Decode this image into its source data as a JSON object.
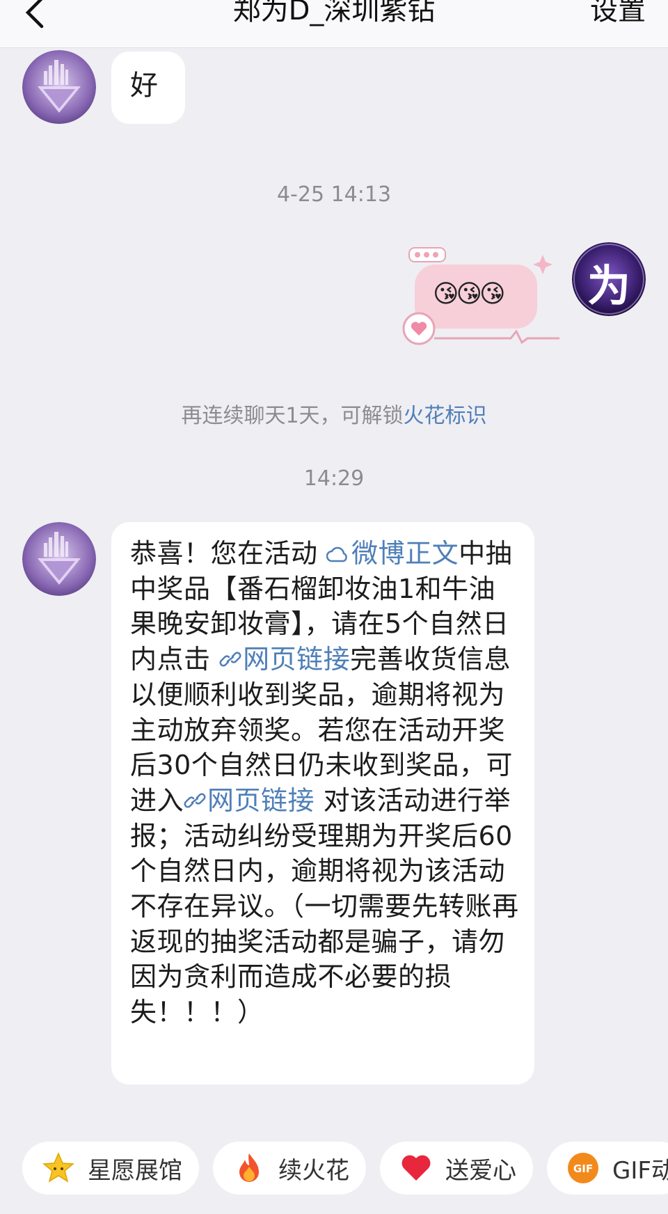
{
  "header": {
    "title": "郑为D_深圳紫钻",
    "settings_label": "设置"
  },
  "messages": {
    "first_text": "好",
    "timestamp_1": "4-25 14:13",
    "sticker_emojis": "😘😘😘",
    "system_notice": {
      "prefix": "再连续聊天1天，可解锁",
      "link": "火花标识"
    },
    "timestamp_2": "14:29",
    "prize": {
      "part1": "恭喜！您在活动 ",
      "link1": "微博正文",
      "part2": "中抽中奖品【番石榴卸妆油1和牛油果晚安卸妆膏】，请在5个自然日内点击 ",
      "link2": "网页链接",
      "part3": "完善收货信息以便顺利收到奖品，逾期将视为主动放弃领奖。若您在活动开奖后30个自然日仍未收到奖品，可进入",
      "link3": "网页链接",
      "part4": " 对该活动进行举报；活动纠纷受理期为开奖后60个自然日内，逾期将视为该活动不存在异议。（一切需要先转账再返现的抽奖活动都是骗子，请勿因为贪利而造成不必要的损失！！！）"
    }
  },
  "avatar_self_char": "为",
  "quick_actions": [
    {
      "label": "星愿展馆",
      "icon": "star-icon"
    },
    {
      "label": "续火花",
      "icon": "flame-icon"
    },
    {
      "label": "送爱心",
      "icon": "heart-icon"
    },
    {
      "label": "GIF动",
      "icon": "gif-icon"
    }
  ],
  "colors": {
    "link": "#4f7fb8",
    "background": "#efeef3",
    "self_avatar": "#3a1f6e"
  }
}
